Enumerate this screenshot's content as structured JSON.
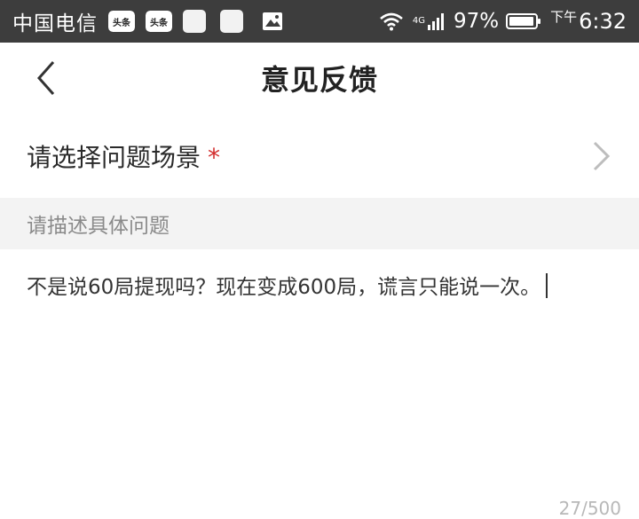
{
  "status_bar": {
    "carrier": "中国电信",
    "app_badges": [
      "头条",
      "头条"
    ],
    "network": "4G",
    "battery_percent": "97%",
    "am_pm": "下午",
    "time": "6:32"
  },
  "header": {
    "title": "意见反馈"
  },
  "scene": {
    "label": "请选择问题场景",
    "required_mark": "*"
  },
  "description": {
    "label": "请描述具体问题",
    "text": "不是说60局提现吗？现在变成600局，谎言只能说一次。",
    "counter": "27/500"
  },
  "colors": {
    "status_bar_bg": "#3d3d3d",
    "required": "#d32f2f",
    "section_bg": "#f3f3f3"
  }
}
